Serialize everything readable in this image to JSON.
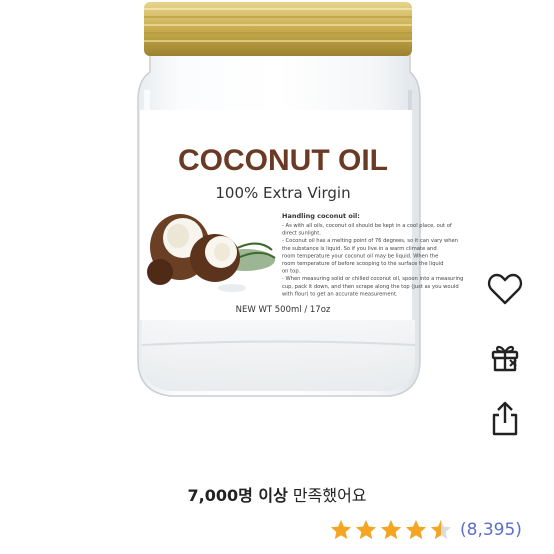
{
  "label": {
    "title": "COCONUT OIL",
    "subtitle": "100% Extra Virgin",
    "handling_heading": "Handling coconut oil:",
    "handling_lines": [
      "- As with all oils, coconut oil should be kept in a cool place, out of",
      "direct sunlight.",
      "- Coconut oil has a melting point of 76 degrees, so it can vary when",
      "the substance is liquid. So if you live in a warm climate and",
      "room temperature your coconut oil may be liquid. When the",
      "room temperature of before scooping to the surface the liquid",
      "on top.",
      "- When measuring solid or chilled coconut oil, spoon into a measuring",
      "cup, pack it down, and then scrape along the top (just as you would",
      "with flour) to get an accurate measurement."
    ],
    "net_weight": "NEW WT 500ml / 17oz"
  },
  "satisfaction": {
    "count_text": "7,000명 이상",
    "suffix_text": " 만족했어요"
  },
  "rating": {
    "value": 4.5,
    "max": 5,
    "count_label": "(8,395)",
    "star_color": "#f4a623"
  },
  "actions": {
    "like_icon": "heart-icon",
    "gift_icon": "gift-icon",
    "share_icon": "share-icon"
  }
}
